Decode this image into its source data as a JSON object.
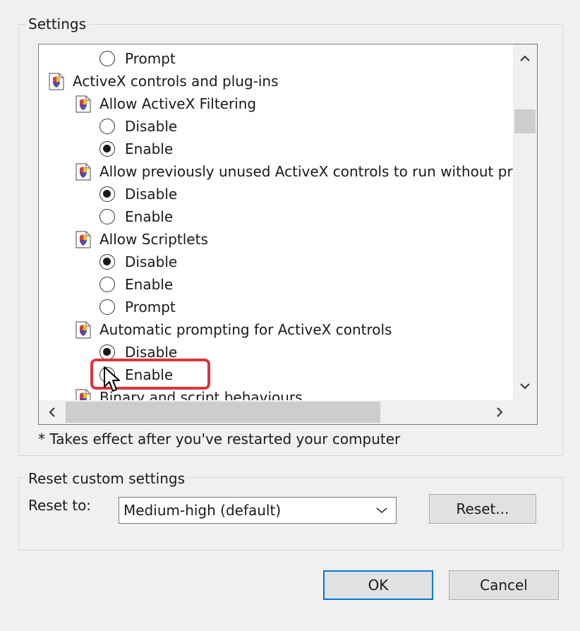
{
  "settings_group": {
    "label": "Settings",
    "rows": [
      {
        "kind": "option",
        "indent": 2,
        "checked": false,
        "label": "Prompt"
      },
      {
        "kind": "category",
        "indent": 0,
        "label": "ActiveX controls and plug-ins"
      },
      {
        "kind": "category",
        "indent": 1,
        "label": "Allow ActiveX Filtering"
      },
      {
        "kind": "option",
        "indent": 2,
        "checked": false,
        "label": "Disable"
      },
      {
        "kind": "option",
        "indent": 2,
        "checked": true,
        "label": "Enable"
      },
      {
        "kind": "category",
        "indent": 1,
        "label": "Allow previously unused ActiveX controls to run without prom"
      },
      {
        "kind": "option",
        "indent": 2,
        "checked": true,
        "label": "Disable"
      },
      {
        "kind": "option",
        "indent": 2,
        "checked": false,
        "label": "Enable"
      },
      {
        "kind": "category",
        "indent": 1,
        "label": "Allow Scriptlets"
      },
      {
        "kind": "option",
        "indent": 2,
        "checked": true,
        "label": "Disable"
      },
      {
        "kind": "option",
        "indent": 2,
        "checked": false,
        "label": "Enable"
      },
      {
        "kind": "option",
        "indent": 2,
        "checked": false,
        "label": "Prompt"
      },
      {
        "kind": "category",
        "indent": 1,
        "label": "Automatic prompting for ActiveX controls"
      },
      {
        "kind": "option",
        "indent": 2,
        "checked": true,
        "label": "Disable"
      },
      {
        "kind": "option",
        "indent": 2,
        "checked": false,
        "label": "Enable"
      },
      {
        "kind": "category",
        "indent": 1,
        "label": "Binary and script behaviours"
      }
    ],
    "footnote": "* Takes effect after you've restarted your computer"
  },
  "reset_group": {
    "label": "Reset custom settings",
    "reset_to_label": "Reset to:",
    "selected_level": "Medium-high (default)",
    "reset_button": "Reset..."
  },
  "footer": {
    "ok": "OK",
    "cancel": "Cancel"
  },
  "colors": {
    "highlight": "#d9363e",
    "default_button_border": "#0078d7"
  }
}
